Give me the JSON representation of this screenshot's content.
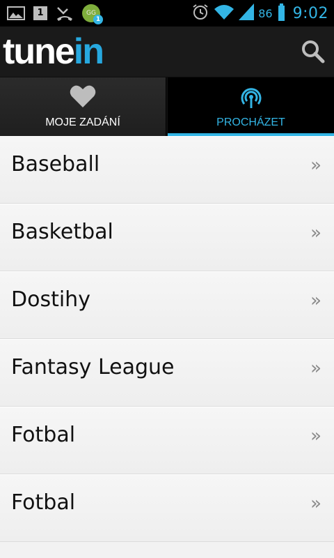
{
  "status_bar": {
    "battery_level": "86",
    "time": "9:02",
    "notification_badge": "1",
    "app_icon_text": "GG",
    "calendar_day": "1",
    "icons": [
      "gallery-icon",
      "calendar-icon",
      "missed-call-icon",
      "google-voice-icon",
      "alarm-icon",
      "wifi-icon",
      "signal-icon",
      "battery-icon"
    ]
  },
  "app_bar": {
    "logo_part1": "tune",
    "logo_part2": "in",
    "search_icon": "search-icon",
    "logo_blue": "#27a8df"
  },
  "tabs": [
    {
      "label": "MOJE ZADÁNÍ",
      "icon": "heart-icon",
      "selected": false
    },
    {
      "label": "PROCHÁZET",
      "icon": "broadcast-icon",
      "selected": true
    }
  ],
  "accent_color": "#33b5e5",
  "list": {
    "items": [
      {
        "label": "Baseball"
      },
      {
        "label": "Basketbal"
      },
      {
        "label": "Dostihy"
      },
      {
        "label": "Fantasy League"
      },
      {
        "label": "Fotbal"
      },
      {
        "label": "Fotbal"
      }
    ],
    "chevron": "»"
  }
}
